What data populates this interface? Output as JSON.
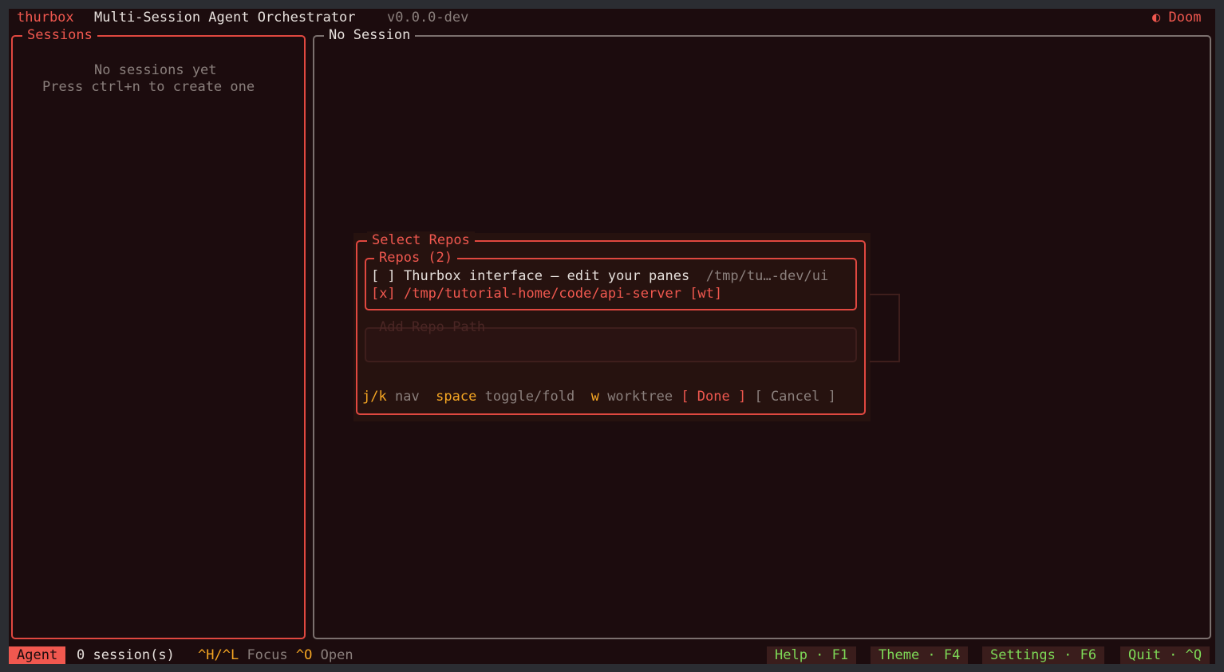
{
  "header": {
    "app_name": "thurbox",
    "subtitle": "Multi-Session Agent Orchestrator",
    "version": "v0.0.0-dev",
    "theme_icon": "moon-icon",
    "theme_name": "Doom"
  },
  "sessions_panel": {
    "title": "Sessions",
    "empty_line1": "No sessions yet",
    "empty_line2": "Press ctrl+n to create one"
  },
  "main_panel": {
    "title": "No Session"
  },
  "modal": {
    "title": "Select Repos",
    "repos_title": "Repos (2)",
    "repos": [
      {
        "check": "[ ]",
        "label": "Thurbox interface — edit your panes",
        "path": "/tmp/tu…-dev/ui"
      },
      {
        "check": "[x]",
        "label": "/tmp/tutorial-home/code/api-server [wt]",
        "path": ""
      }
    ],
    "add_path_title": "Add Repo Path",
    "hints": {
      "nav_key": "j/k",
      "nav_label": "nav",
      "toggle_key": "space",
      "toggle_label": "toggle/fold",
      "worktree_key": "w",
      "worktree_label": "worktree"
    },
    "done_label": "[ Done ]",
    "cancel_label": "[ Cancel ]"
  },
  "statusbar": {
    "mode": "Agent",
    "session_count": "0 session(s)",
    "focus_key": "^H/^L",
    "focus_label": "Focus",
    "open_key": "^O",
    "open_label": "Open",
    "help": "Help · F1",
    "theme": "Theme · F4",
    "settings": "Settings · F6",
    "quit": "Quit · ^Q"
  },
  "colors": {
    "background": "#1c0c0e",
    "accent": "#f0584f",
    "key_hint": "#f5a623",
    "function_key": "#7ed957"
  }
}
